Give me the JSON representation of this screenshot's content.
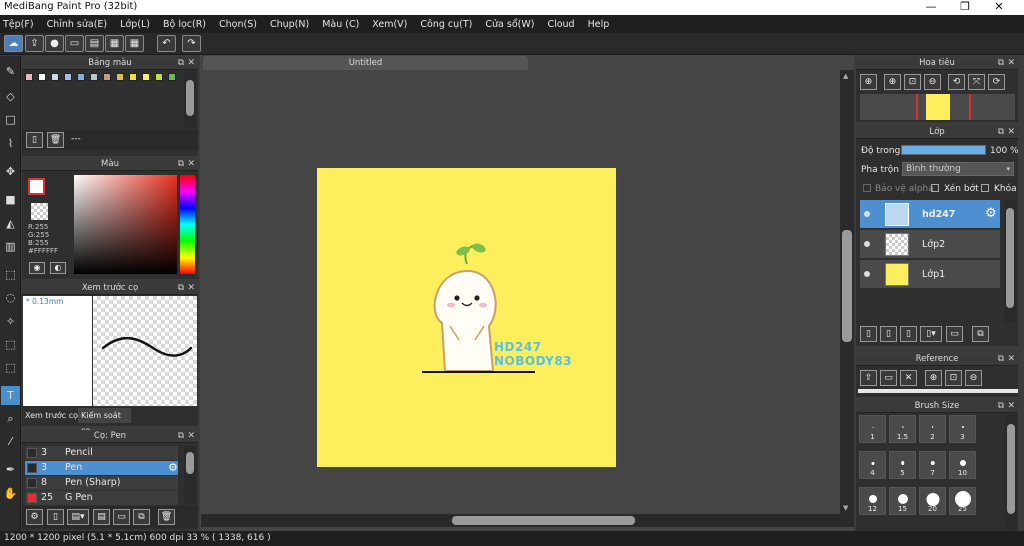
{
  "window": {
    "title": "MediBang Paint Pro (32bit)",
    "min": "—",
    "max": "❐",
    "close": "✕"
  },
  "menu": [
    "Tệp(F)",
    "Chỉnh sửa(E)",
    "Lớp(L)",
    "Bộ lọc(R)",
    "Chọn(S)",
    "Chụp(N)",
    "Màu (C)",
    "Xem(V)",
    "Công cụ(T)",
    "Cửa sổ(W)",
    "Cloud",
    "Help"
  ],
  "toolbar": {
    "icons": [
      "cloud-icon",
      "export-icon",
      "comment-icon",
      "screen-icon",
      "page-icon",
      "grid-icon",
      "grid2-icon",
      "undo-icon",
      "redo-icon"
    ],
    "undo": "↶",
    "redo": "↷"
  },
  "palette": {
    "title": "Bảng màu",
    "swatches": [
      "#f3b6c0",
      "#ffffff",
      "#cfd8e4",
      "#9fc0e4",
      "#7fb0e0",
      "#b0c8d8",
      "#c0a080",
      "#e0c040",
      "#f0e040",
      "#f8f060",
      "#c0e040",
      "#60c060"
    ],
    "footer_text": "---"
  },
  "color": {
    "title": "Màu",
    "r": "R:255",
    "g": "G:255",
    "b": "B:255",
    "hex": "#FFFFFF",
    "fg": "#ffffff",
    "hue": "#e83020"
  },
  "brush_preview": {
    "title": "Xem trước cọ",
    "size": "* 0.13mm",
    "tab1": "Xem trước cọ",
    "tab2": "Kiểm soát cọ"
  },
  "brush_list": {
    "title": "Cọ: Pen",
    "items": [
      {
        "size": "3",
        "name": "Pencil",
        "color": "#2a2a2a"
      },
      {
        "size": "3",
        "name": "Pen",
        "color": "#2a2a2a"
      },
      {
        "size": "8",
        "name": "Pen (Sharp)",
        "color": "#2a2a2a"
      },
      {
        "size": "25",
        "name": "G Pen",
        "color": "#e03030"
      }
    ]
  },
  "canvas": {
    "tab": "Untitled",
    "art_text_1": "HD247",
    "art_text_2": "NOBODY83",
    "bg": "#fdee5d"
  },
  "navigator": {
    "title": "Hoa tiêu"
  },
  "layer_panel": {
    "title": "Lớp",
    "opacity_label": "Độ trong",
    "opacity_value": "100 %",
    "opacity": 1.0,
    "blend_label": "Pha trộn",
    "blend_value": "Bình thường",
    "protect_alpha": "Bảo vệ alpha",
    "clipping": "Xén bớt",
    "lock": "Khóa",
    "layers": [
      {
        "name": "hd247"
      },
      {
        "name": "Lớp2"
      },
      {
        "name": "Lớp1"
      }
    ]
  },
  "reference": {
    "title": "Reference"
  },
  "brush_size": {
    "title": "Brush Size",
    "sizes": [
      "1",
      "1.5",
      "2",
      "3",
      "4",
      "5",
      "7",
      "10",
      "12",
      "15",
      "20",
      "25"
    ]
  },
  "status": {
    "text": "1200 * 1200 pixel   (5.1 * 5.1cm)   600 dpi   33 %   ( 1338, 616 )"
  }
}
